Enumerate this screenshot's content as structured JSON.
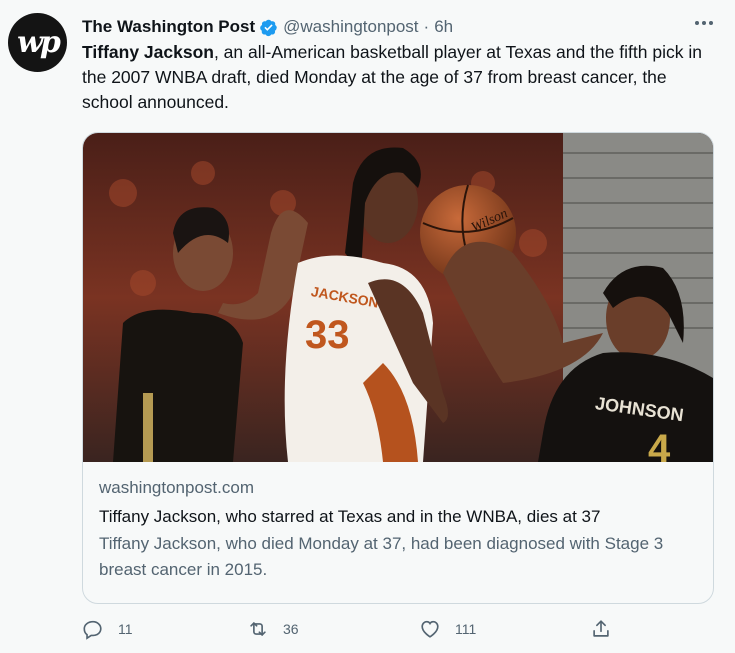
{
  "tweet": {
    "author_name": "The Washington Post",
    "handle": "@washingtonpost",
    "separator": "·",
    "time": "6h",
    "avatar_text": "wp",
    "text_bold": "Tiffany Jackson",
    "text_rest": ", an all-American basketball player at Texas and the fifth pick in the 2007 WNBA draft, died Monday at the age of 37 from breast cancer, the school announced.",
    "card": {
      "domain": "washingtonpost.com",
      "title": "Tiffany Jackson, who starred at Texas and in the WNBA, dies at 37",
      "description": "Tiffany Jackson, who died Monday at 37, had been diagnosed with Stage 3 breast cancer in 2015.",
      "jersey_text_left": "JACKSON",
      "jersey_number_left": "33",
      "jersey_text_right": "JOHNSON",
      "jersey_number_right": "4",
      "ball_text": "Wilson"
    },
    "actions": {
      "replies": "11",
      "retweets": "36",
      "likes": "111"
    }
  },
  "colors": {
    "verified": "#1d9bf0",
    "secondary_text": "#536471",
    "primary_text": "#0f1419",
    "border": "#cfd9de",
    "background": "#f7f9f9"
  },
  "icons": [
    "verified-badge-icon",
    "more-icon",
    "reply-icon",
    "retweet-icon",
    "like-icon",
    "share-icon"
  ]
}
